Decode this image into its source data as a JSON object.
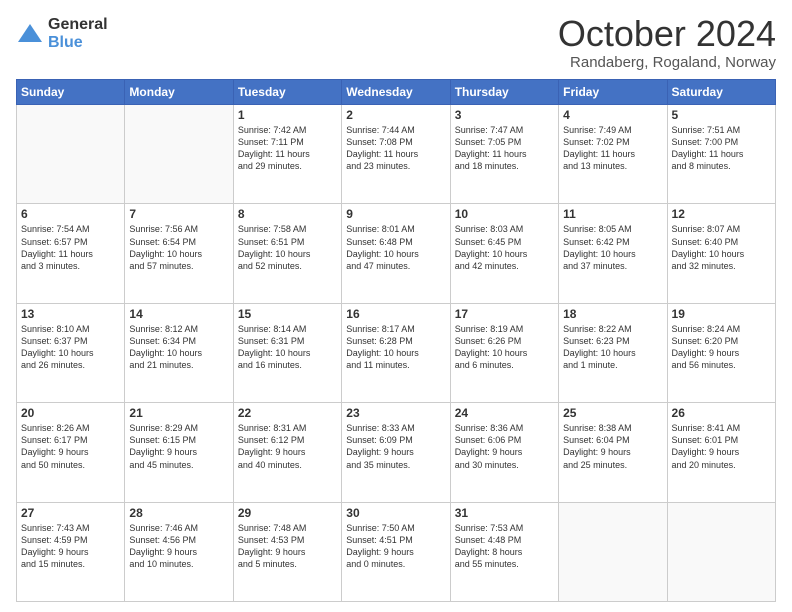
{
  "logo": {
    "line1": "General",
    "line2": "Blue"
  },
  "header": {
    "month": "October 2024",
    "location": "Randaberg, Rogaland, Norway"
  },
  "weekdays": [
    "Sunday",
    "Monday",
    "Tuesday",
    "Wednesday",
    "Thursday",
    "Friday",
    "Saturday"
  ],
  "weeks": [
    [
      {
        "day": "",
        "info": ""
      },
      {
        "day": "",
        "info": ""
      },
      {
        "day": "1",
        "info": "Sunrise: 7:42 AM\nSunset: 7:11 PM\nDaylight: 11 hours\nand 29 minutes."
      },
      {
        "day": "2",
        "info": "Sunrise: 7:44 AM\nSunset: 7:08 PM\nDaylight: 11 hours\nand 23 minutes."
      },
      {
        "day": "3",
        "info": "Sunrise: 7:47 AM\nSunset: 7:05 PM\nDaylight: 11 hours\nand 18 minutes."
      },
      {
        "day": "4",
        "info": "Sunrise: 7:49 AM\nSunset: 7:02 PM\nDaylight: 11 hours\nand 13 minutes."
      },
      {
        "day": "5",
        "info": "Sunrise: 7:51 AM\nSunset: 7:00 PM\nDaylight: 11 hours\nand 8 minutes."
      }
    ],
    [
      {
        "day": "6",
        "info": "Sunrise: 7:54 AM\nSunset: 6:57 PM\nDaylight: 11 hours\nand 3 minutes."
      },
      {
        "day": "7",
        "info": "Sunrise: 7:56 AM\nSunset: 6:54 PM\nDaylight: 10 hours\nand 57 minutes."
      },
      {
        "day": "8",
        "info": "Sunrise: 7:58 AM\nSunset: 6:51 PM\nDaylight: 10 hours\nand 52 minutes."
      },
      {
        "day": "9",
        "info": "Sunrise: 8:01 AM\nSunset: 6:48 PM\nDaylight: 10 hours\nand 47 minutes."
      },
      {
        "day": "10",
        "info": "Sunrise: 8:03 AM\nSunset: 6:45 PM\nDaylight: 10 hours\nand 42 minutes."
      },
      {
        "day": "11",
        "info": "Sunrise: 8:05 AM\nSunset: 6:42 PM\nDaylight: 10 hours\nand 37 minutes."
      },
      {
        "day": "12",
        "info": "Sunrise: 8:07 AM\nSunset: 6:40 PM\nDaylight: 10 hours\nand 32 minutes."
      }
    ],
    [
      {
        "day": "13",
        "info": "Sunrise: 8:10 AM\nSunset: 6:37 PM\nDaylight: 10 hours\nand 26 minutes."
      },
      {
        "day": "14",
        "info": "Sunrise: 8:12 AM\nSunset: 6:34 PM\nDaylight: 10 hours\nand 21 minutes."
      },
      {
        "day": "15",
        "info": "Sunrise: 8:14 AM\nSunset: 6:31 PM\nDaylight: 10 hours\nand 16 minutes."
      },
      {
        "day": "16",
        "info": "Sunrise: 8:17 AM\nSunset: 6:28 PM\nDaylight: 10 hours\nand 11 minutes."
      },
      {
        "day": "17",
        "info": "Sunrise: 8:19 AM\nSunset: 6:26 PM\nDaylight: 10 hours\nand 6 minutes."
      },
      {
        "day": "18",
        "info": "Sunrise: 8:22 AM\nSunset: 6:23 PM\nDaylight: 10 hours\nand 1 minute."
      },
      {
        "day": "19",
        "info": "Sunrise: 8:24 AM\nSunset: 6:20 PM\nDaylight: 9 hours\nand 56 minutes."
      }
    ],
    [
      {
        "day": "20",
        "info": "Sunrise: 8:26 AM\nSunset: 6:17 PM\nDaylight: 9 hours\nand 50 minutes."
      },
      {
        "day": "21",
        "info": "Sunrise: 8:29 AM\nSunset: 6:15 PM\nDaylight: 9 hours\nand 45 minutes."
      },
      {
        "day": "22",
        "info": "Sunrise: 8:31 AM\nSunset: 6:12 PM\nDaylight: 9 hours\nand 40 minutes."
      },
      {
        "day": "23",
        "info": "Sunrise: 8:33 AM\nSunset: 6:09 PM\nDaylight: 9 hours\nand 35 minutes."
      },
      {
        "day": "24",
        "info": "Sunrise: 8:36 AM\nSunset: 6:06 PM\nDaylight: 9 hours\nand 30 minutes."
      },
      {
        "day": "25",
        "info": "Sunrise: 8:38 AM\nSunset: 6:04 PM\nDaylight: 9 hours\nand 25 minutes."
      },
      {
        "day": "26",
        "info": "Sunrise: 8:41 AM\nSunset: 6:01 PM\nDaylight: 9 hours\nand 20 minutes."
      }
    ],
    [
      {
        "day": "27",
        "info": "Sunrise: 7:43 AM\nSunset: 4:59 PM\nDaylight: 9 hours\nand 15 minutes."
      },
      {
        "day": "28",
        "info": "Sunrise: 7:46 AM\nSunset: 4:56 PM\nDaylight: 9 hours\nand 10 minutes."
      },
      {
        "day": "29",
        "info": "Sunrise: 7:48 AM\nSunset: 4:53 PM\nDaylight: 9 hours\nand 5 minutes."
      },
      {
        "day": "30",
        "info": "Sunrise: 7:50 AM\nSunset: 4:51 PM\nDaylight: 9 hours\nand 0 minutes."
      },
      {
        "day": "31",
        "info": "Sunrise: 7:53 AM\nSunset: 4:48 PM\nDaylight: 8 hours\nand 55 minutes."
      },
      {
        "day": "",
        "info": ""
      },
      {
        "day": "",
        "info": ""
      }
    ]
  ]
}
